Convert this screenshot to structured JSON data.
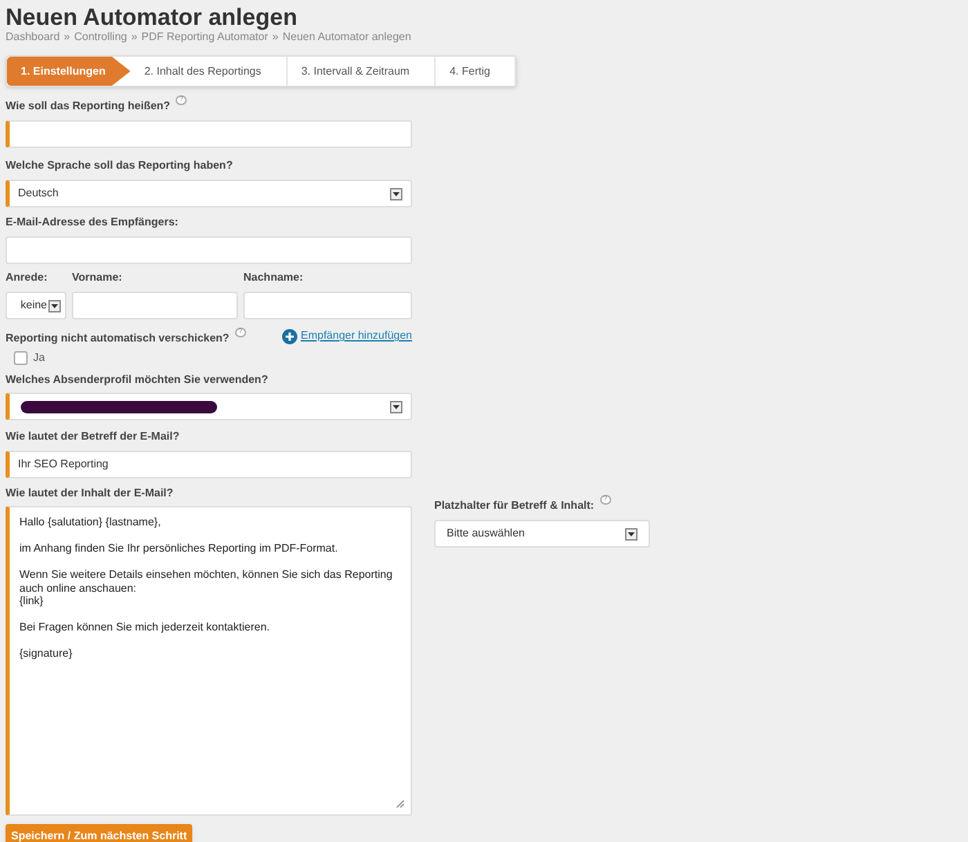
{
  "page": {
    "title": "Neuen Automator anlegen",
    "breadcrumb": [
      "Dashboard",
      "Controlling",
      "PDF Reporting Automator",
      "Neuen Automator anlegen"
    ],
    "breadcrumb_separator": "»"
  },
  "steps": [
    {
      "label": "1. Einstellungen",
      "selected": true
    },
    {
      "label": "2. Inhalt des Reportings",
      "selected": false
    },
    {
      "label": "3. Intervall & Zeitraum",
      "selected": false
    },
    {
      "label": "4. Fertig",
      "selected": false
    }
  ],
  "form": {
    "report_name": {
      "label": "Wie soll das Reporting heißen?",
      "help": "?",
      "required": true
    },
    "language": {
      "label": "Welche Sprache soll das Reporting haben?",
      "value": "Deutsch",
      "required": true
    },
    "recipient_email": {
      "label": "E-Mail-Adresse des Empfängers:",
      "required": false
    },
    "salutation": {
      "label": "Anrede:",
      "value": "keine"
    },
    "first_name": {
      "label": "Vorname:"
    },
    "last_name": {
      "label": "Nachname:"
    },
    "add_recipient": {
      "label": "Empfänger hinzufügen"
    },
    "no_auto_send": {
      "label": "Reporting nicht automatisch verschicken?",
      "help": "?",
      "option": "Ja",
      "checked": false
    },
    "sender_profile": {
      "label": "Welches Absenderprofil möchten Sie verwenden?",
      "redacted": true,
      "required": true
    },
    "subject": {
      "label": "Wie lautet der Betreff der E-Mail?",
      "value": "Ihr SEO Reporting",
      "required": true
    },
    "body": {
      "label": "Wie lautet der Inhalt der E-Mail?",
      "value": "Hallo {salutation} {lastname},\n\nim Anhang finden Sie Ihr persönliches Reporting im PDF-Format.\n\nWenn Sie weitere Details einsehen möchten, können Sie sich das Reporting auch online anschauen:\n{link}\n\nBei Fragen können Sie mich jederzeit kontaktieren.\n\n{signature}",
      "required": true
    },
    "placeholders": {
      "label": "Platzhalter für Betreff & Inhalt:",
      "help": "?",
      "value": "Bitte auswählen"
    },
    "submit": {
      "label": "Speichern / Zum nächsten Schritt"
    }
  }
}
